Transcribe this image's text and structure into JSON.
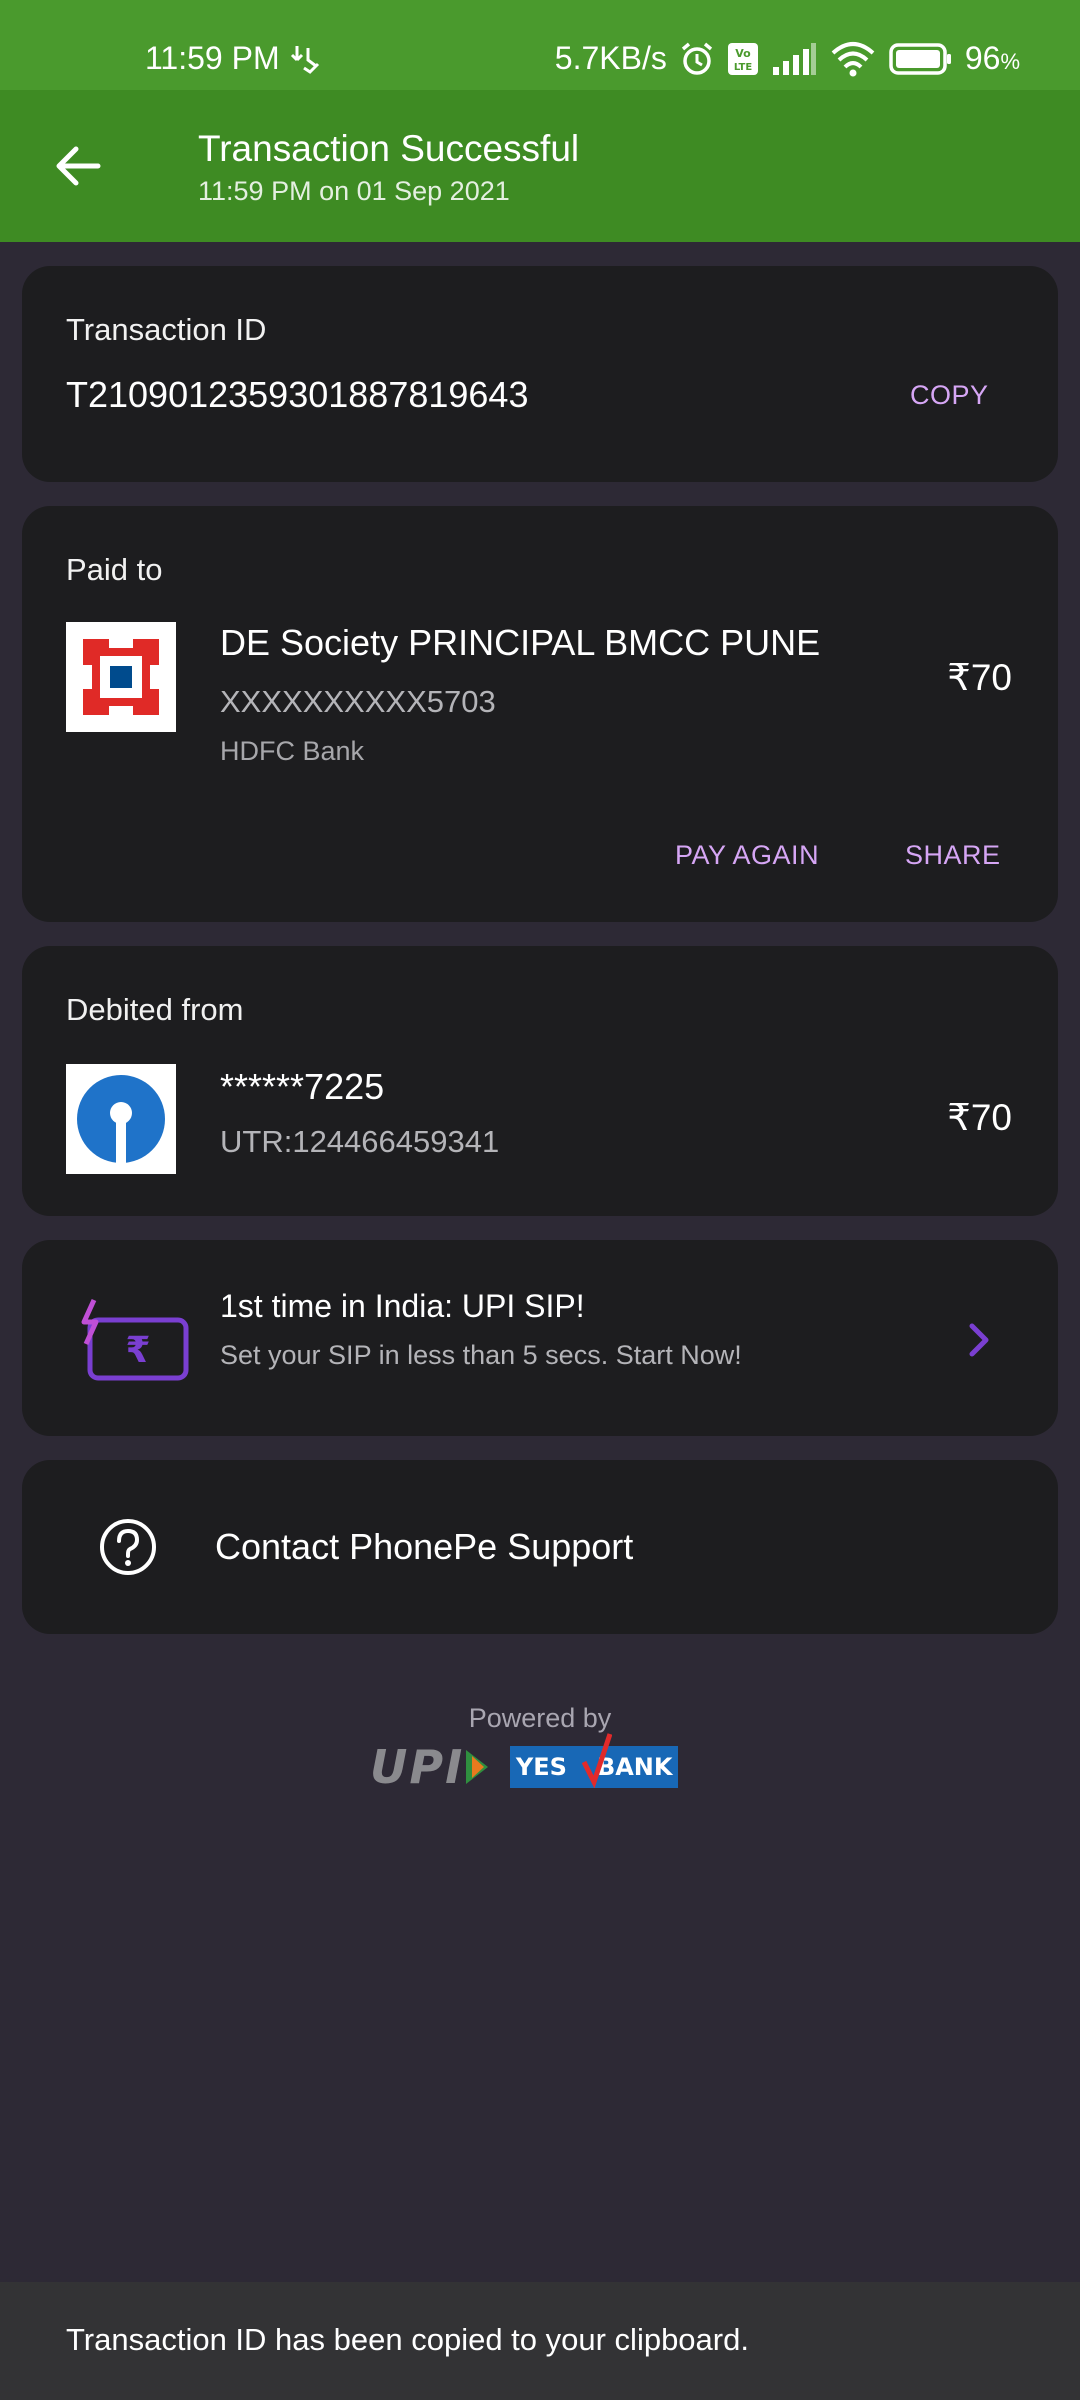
{
  "status_bar": {
    "time": "11:59 PM",
    "network_speed": "5.7KB/s",
    "battery": "96",
    "battery_unit": "%",
    "icons": [
      "download-status-icon",
      "alarm-icon",
      "volte-icon",
      "signal-icon",
      "wifi-icon",
      "battery-icon"
    ]
  },
  "header": {
    "title": "Transaction Successful",
    "subtitle": "11:59 PM on 01 Sep 2021",
    "background": "#3e8b23"
  },
  "transaction": {
    "label": "Transaction ID",
    "id": "T2109012359301887819643",
    "copy_label": "COPY"
  },
  "paid_to": {
    "label": "Paid to",
    "name": "DE Society PRINCIPAL BMCC PUNE",
    "account": "XXXXXXXXXX5703",
    "bank": "HDFC Bank",
    "amount": "₹70",
    "pay_again_label": "PAY AGAIN",
    "share_label": "SHARE"
  },
  "debited_from": {
    "label": "Debited from",
    "account": "******7225",
    "utr": "UTR:124466459341",
    "amount": "₹70"
  },
  "promo": {
    "title": "1st time in India: UPI SIP!",
    "subtitle": "Set your SIP in less than 5 secs. Start Now!"
  },
  "support": {
    "label": "Contact PhonePe Support"
  },
  "footer": {
    "powered_by": "Powered by",
    "upi_logo_text": "UPI",
    "yes_logo_text": "YES",
    "bank_logo_text": "BANK"
  },
  "toast": {
    "message": "Transaction ID has been copied to your clipboard."
  },
  "colors": {
    "accent_purple": "#d6a6f5",
    "card": "#1d1d1f",
    "page": "#2d2935"
  }
}
